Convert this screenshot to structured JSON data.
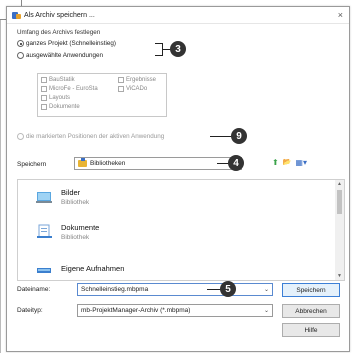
{
  "window": {
    "title": "Als Archiv speichern ...",
    "close_glyph": "×"
  },
  "scope": {
    "group_label": "Umfang des Archivs festlegen",
    "option_project": "ganzes Projekt (Schnelleinstieg)",
    "option_selected": "ausgewählte Anwendungen",
    "option_marked": "die markierten Positionen der aktiven Anwendung",
    "selected_option": "project",
    "applications": [
      "BauStatik",
      "MicroFe - EuroSta",
      "Layouts",
      "Dokumente",
      "Ergebnisse",
      "ViCADo"
    ]
  },
  "callouts": {
    "c3": "3",
    "c4": "4",
    "c5": "5",
    "c9": "9"
  },
  "save_location": {
    "label": "Speichern",
    "value": "Bibliotheken"
  },
  "file_list": {
    "items": [
      {
        "name": "Bilder",
        "type": "Bibliothek"
      },
      {
        "name": "Dokumente",
        "type": "Bibliothek"
      },
      {
        "name": "Eigene Aufnahmen",
        "type": ""
      }
    ]
  },
  "filename": {
    "label": "Dateiname:",
    "value": "Schnelleinstieg.mbpma"
  },
  "filetype": {
    "label": "Dateityp:",
    "value": "mb-ProjektManager-Archiv (*.mbpma)"
  },
  "buttons": {
    "save": "Speichern",
    "cancel": "Abbrechen",
    "help": "Hilfe"
  },
  "icons": {
    "chevron_down": "⌄",
    "scroll_up": "▲",
    "scroll_down": "▼",
    "nav_up": "⬆",
    "new_folder": "📂",
    "view_menu": "▦▾"
  },
  "colors": {
    "accent": "#3c7fd6",
    "callout": "#333333"
  }
}
